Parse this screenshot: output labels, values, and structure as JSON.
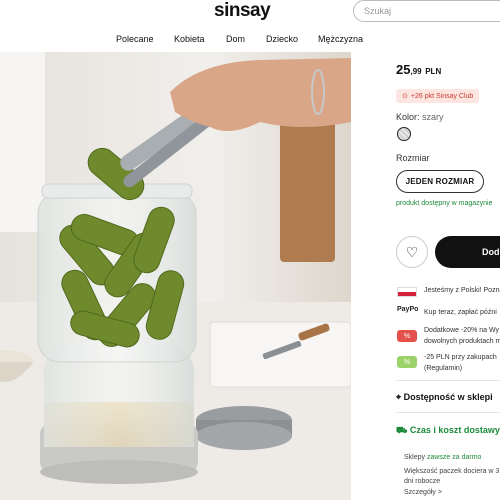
{
  "header": {
    "logo": "sinsay",
    "search_placeholder": "Szukaj"
  },
  "nav": {
    "items": [
      "Polecane",
      "Kobieta",
      "Dom",
      "Dziecko",
      "Mężczyzna"
    ]
  },
  "product": {
    "price_main": "25",
    "price_decimals": ",99",
    "price_currency": "PLN",
    "club_badge": "+26 pkt Sinsay Club",
    "color_label": "Kolor:",
    "color_value": "szary",
    "size_label": "Rozmiar",
    "size_button": "JEDEN ROZMIAR",
    "availability": "produkt dostępny w magazynie",
    "add_button": "Dod"
  },
  "info_rows": [
    {
      "icon": "poland-flag-icon",
      "text": "Jesteśmy z Polski! Pozna"
    },
    {
      "icon": "paypo-icon",
      "icon_text": "PayPo",
      "text": "Kup teraz, zapłać późni"
    },
    {
      "icon": "discount-tag-icon",
      "text": "Dodatkowe -20% na Wy",
      "text2": "dowolnych produktach me"
    },
    {
      "icon": "coupon-icon",
      "text": "-25 PLN przy zakupach",
      "text2": "(Regulamin)"
    }
  ],
  "availability_section": {
    "title": "Dostępność w sklepi"
  },
  "delivery_section": {
    "title": "Czas i koszt dostawy",
    "stores_label": "Sklepy",
    "stores_value": "zawsze za darmo",
    "desc1": "Większość paczek dociera w 3",
    "desc2": "dni robocze",
    "more_link": "Szczegóły >"
  },
  "colors": {
    "accent_green": "#1d8a3a",
    "club_red": "#c93c2b",
    "button_dark": "#111111"
  }
}
